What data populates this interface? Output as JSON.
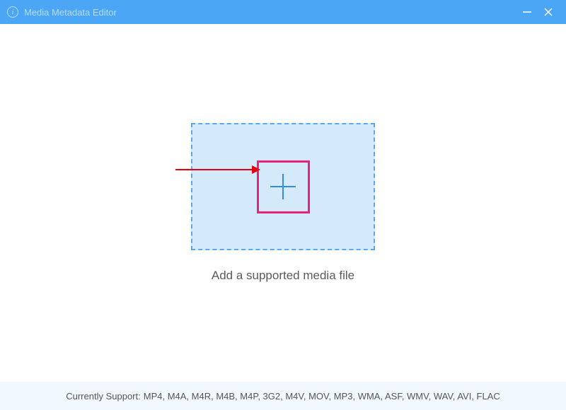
{
  "titlebar": {
    "title": "Media Metadata Editor"
  },
  "main": {
    "instruction": "Add a supported media file"
  },
  "footer": {
    "label": "Currently Support:",
    "formats": "MP4, M4A, M4R, M4B, M4P, 3G2, M4V, MOV, MP3, WMA, ASF, WMV, WAV, AVI, FLAC"
  },
  "annotations": {
    "arrow_points_to": "add-button",
    "highlight_box": "add-button"
  }
}
